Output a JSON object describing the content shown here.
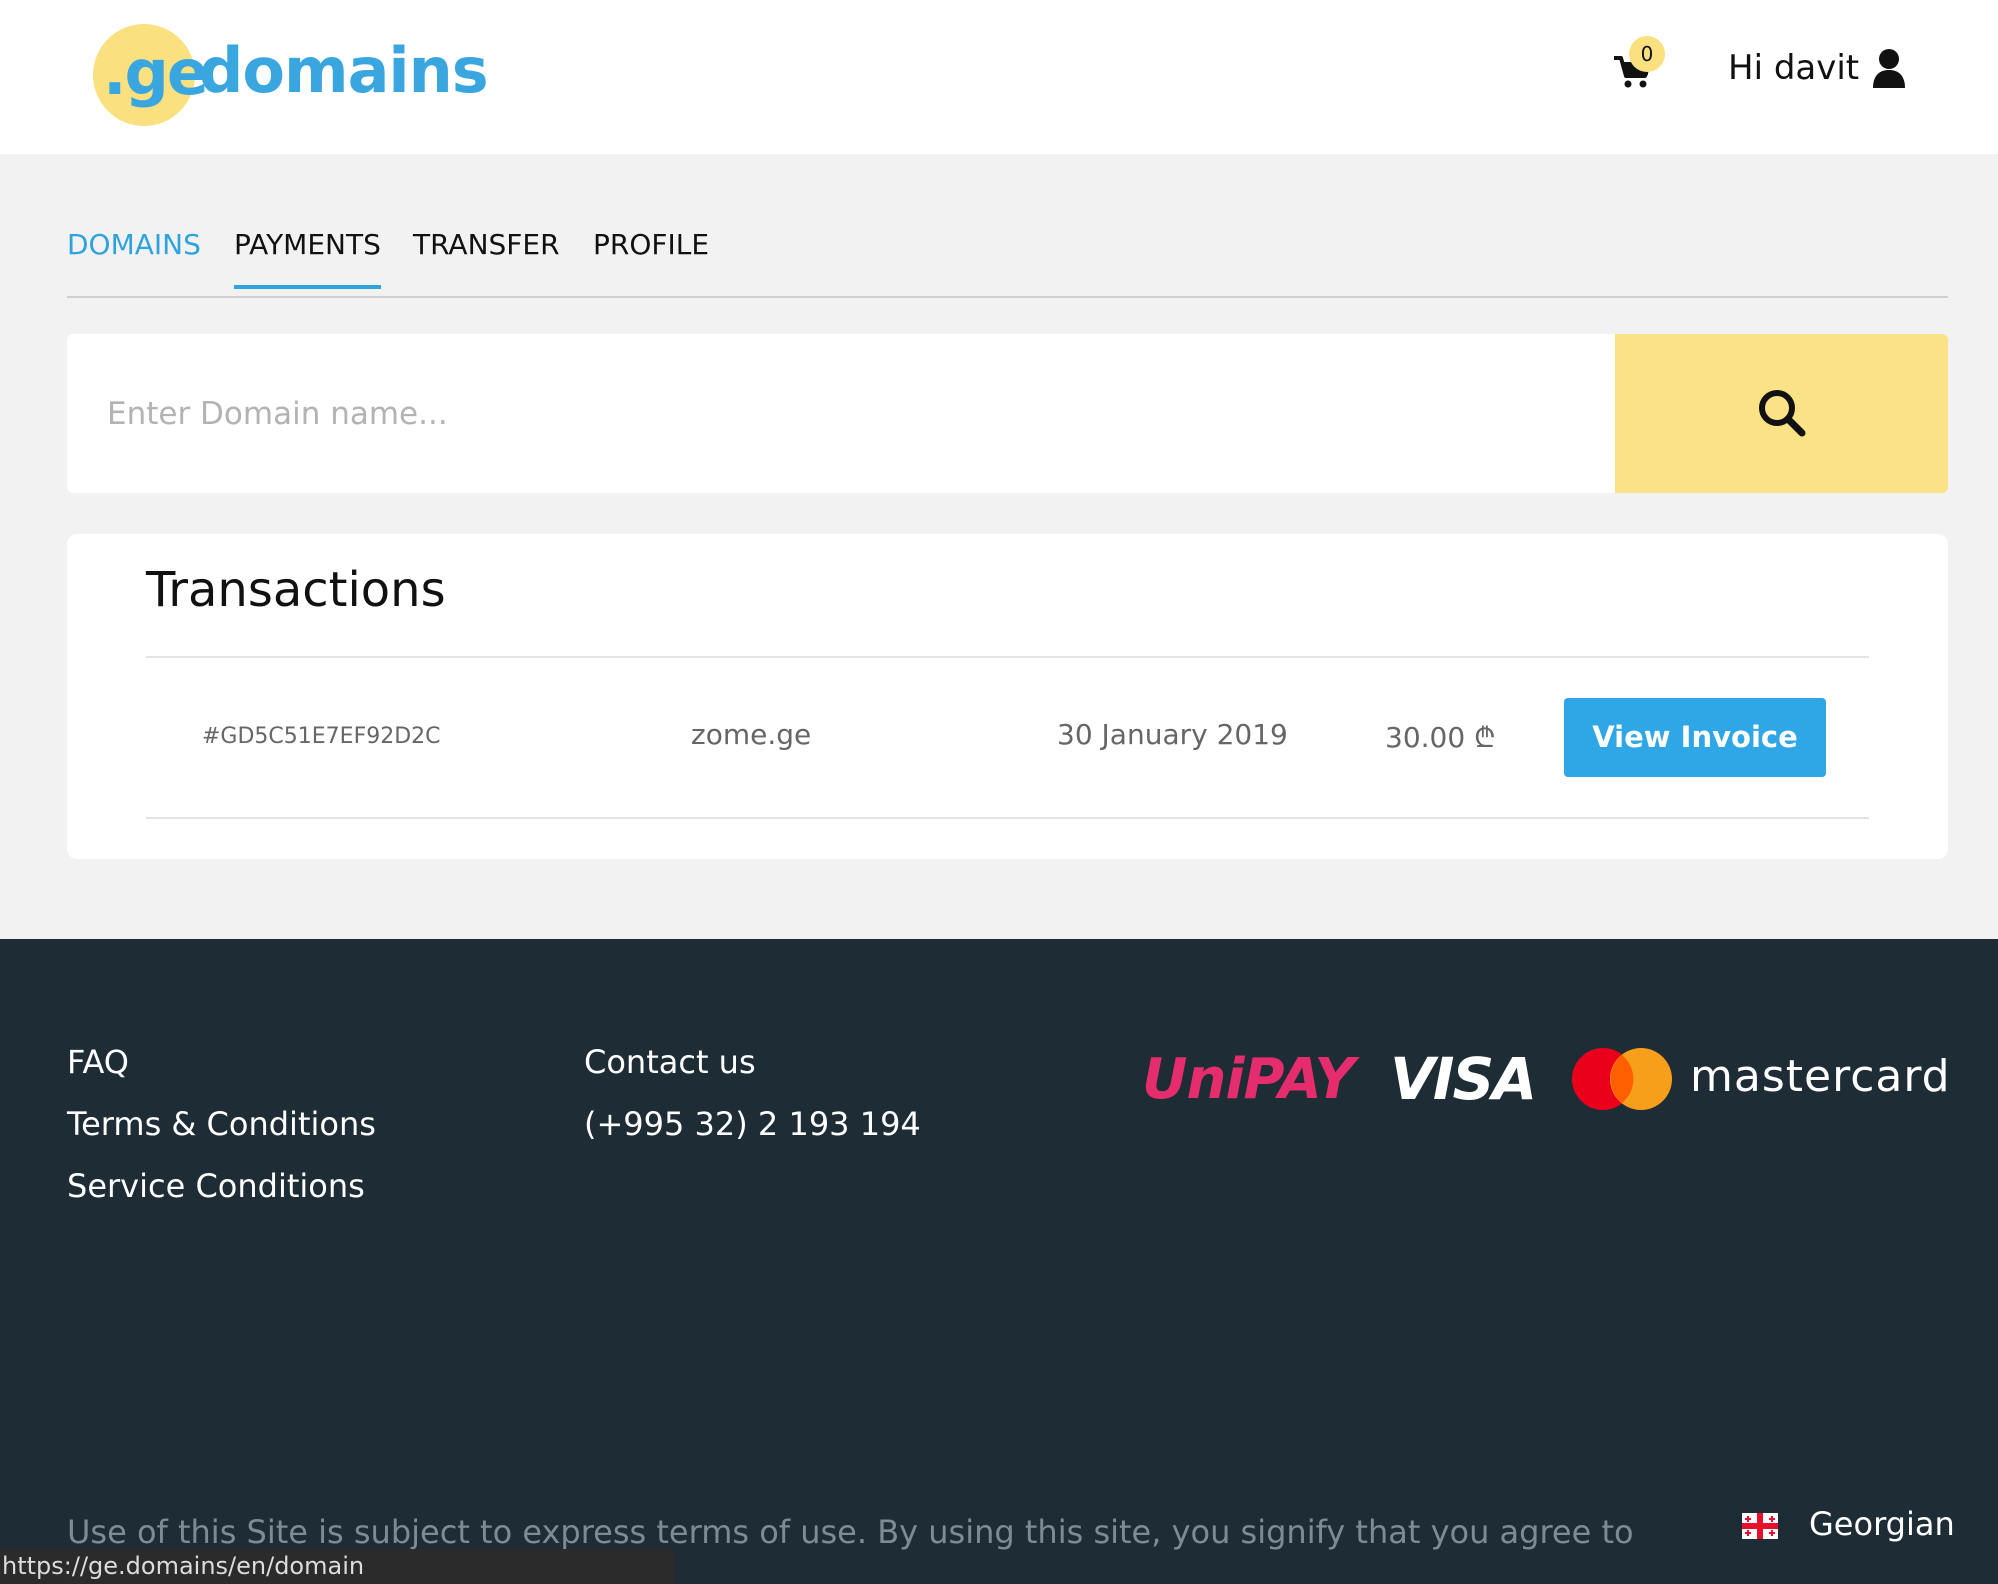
{
  "header": {
    "logo_ge": ".ge",
    "logo_domains": "domains",
    "cart_count": "0",
    "greeting": "Hi davit"
  },
  "tabs": [
    {
      "label": "DOMAINS",
      "state": "active-color"
    },
    {
      "label": "PAYMENTS",
      "state": "selected-underline"
    },
    {
      "label": "TRANSFER"
    },
    {
      "label": "PROFILE"
    }
  ],
  "search": {
    "placeholder": "Enter Domain name..."
  },
  "transactions": {
    "title": "Transactions",
    "rows": [
      {
        "id": "#GD5C51E7EF92D2C",
        "domain": "zome.ge",
        "date": "30 January 2019",
        "amount": "30.00 ₾",
        "action": "View Invoice"
      }
    ]
  },
  "footer": {
    "links": [
      "FAQ",
      "Terms & Conditions",
      "Service Conditions"
    ],
    "contact_label": "Contact us",
    "phone": "(+995 32) 2 193 194",
    "payment_logos": {
      "unipay": "UniPAY",
      "visa": "VISA",
      "mastercard": "mastercard"
    },
    "legal_text": "Use of this Site is subject to express terms of use. By using this site, you signify that you agree to",
    "language": "Georgian"
  },
  "status_bar": {
    "url": "https://ge.domains/en/domain"
  },
  "colors": {
    "accent_blue": "#2fa3dd",
    "logo_yellow": "#fbe07f",
    "search_button_yellow": "#fbe287",
    "footer_bg": "#1e2d35",
    "unipay_pink": "#e52c6d",
    "mastercard_red": "#eb001b",
    "mastercard_orange": "#f79e1b"
  },
  "icons": [
    "cart-icon",
    "user-icon",
    "search-icon",
    "georgia-flag-icon"
  ]
}
